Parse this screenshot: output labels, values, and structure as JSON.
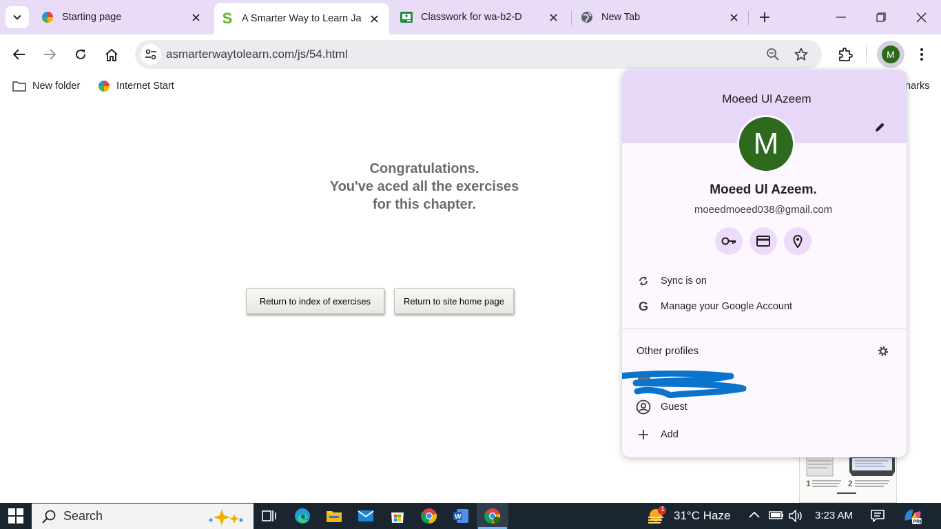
{
  "browser": {
    "tabs": [
      {
        "title": "Starting page"
      },
      {
        "title": "A Smarter Way to Learn Ja"
      },
      {
        "title": "Classwork for wa-b2-D"
      },
      {
        "title": "New Tab"
      }
    ],
    "url": "asmarterwaytolearn.com/js/54.html",
    "profile_initial": "M"
  },
  "bookmarks": {
    "items": [
      {
        "label": "New folder"
      },
      {
        "label": "Internet Start"
      }
    ],
    "overflow_fragment": "narks"
  },
  "page": {
    "message_lines": [
      "Congratulations.",
      "You've aced all the exercises",
      "for this chapter."
    ],
    "btn_index": "Return to index of exercises",
    "btn_home": "Return to site home page"
  },
  "profile_menu": {
    "header_name": "Moeed Ul Azeem",
    "avatar_letter": "M",
    "full_name": "Moeed Ul Azeem.",
    "email": "moeedmoeed038@gmail.com",
    "sync": "Sync is on",
    "manage": "Manage your Google Account",
    "other_profiles": "Other profiles",
    "guest": "Guest",
    "add": "Add",
    "avatar_color": "#2d6a1e",
    "header_color": "#e6d8f6"
  },
  "taskbar": {
    "search": "Search",
    "weather": "31°C  Haze",
    "time": "3:23 AM",
    "weather_badge": "1"
  }
}
